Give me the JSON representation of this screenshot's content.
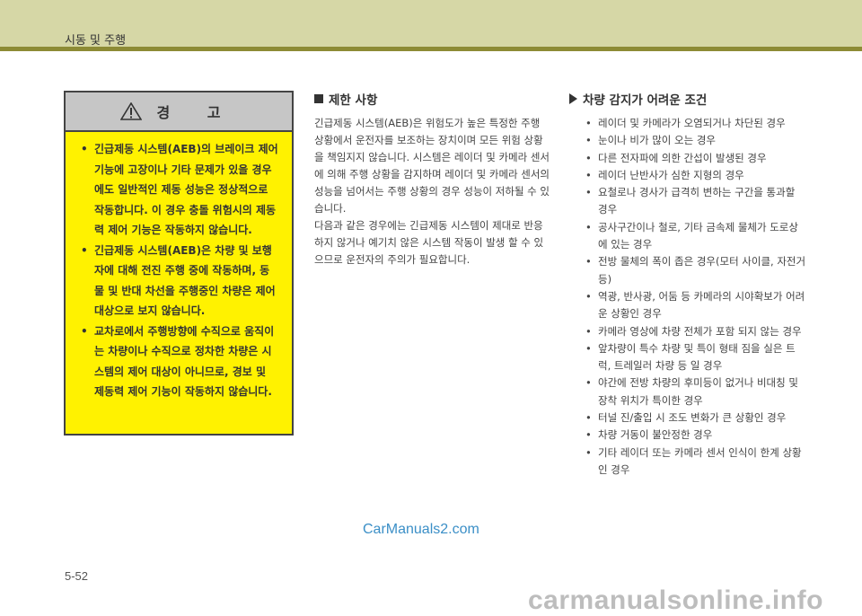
{
  "header": {
    "title": "시동 및 주행"
  },
  "warning": {
    "title": "경 고",
    "items": [
      "긴급제동 시스템(AEB)의 브레이크 제어 기능에 고장이나 기타 문제가 있을 경우에도 일반적인 제동 성능은 정상적으로 작동합니다. 이 경우 충돌 위험시의 제동력 제어 기능은 작동하지 않습니다.",
      "긴급제동 시스템(AEB)은 차량 및 보행자에 대해 전진 주행 중에 작동하며, 동물 및 반대 차선을 주행중인 차량은 제어대상으로 보지 않습니다.",
      "교차로에서 주행방향에 수직으로 움직이는 차량이나 수직으로 정차한 차량은 시스템의 제어 대상이 아니므로, 경보 및 제동력 제어 기능이 작동하지 않습니다."
    ]
  },
  "limitations": {
    "heading": "제한 사항",
    "paragraphs": [
      "긴급제동 시스템(AEB)은 위험도가 높은 특정한 주행 상황에서 운전자를 보조하는 장치이며 모든 위험 상황을 책임지지 않습니다. 시스템은 레이더 및 카메라 센서에 의해 주행 상황을 감지하며 레이더 및 카메라 센서의 성능을 넘어서는 주행 상황의 경우 성능이 저하될 수 있습니다.",
      "다음과 같은 경우에는 긴급제동 시스템이 제대로 반응하지 않거나 예기치 않은 시스템 작동이 발생 할 수 있으므로 운전자의 주의가 필요합니다."
    ]
  },
  "conditions": {
    "heading": "차량 감지가 어려운 조건",
    "items": [
      "레이더 및 카메라가 오염되거나 차단된 경우",
      "눈이나 비가 많이 오는 경우",
      "다른 전자파에 의한 간섭이 발생된 경우",
      "레이더 난반사가 심한 지형의 경우",
      "요철로나 경사가 급격히 변하는 구간을 통과할 경우",
      "공사구간이나 철로, 기타 금속제 물체가 도로상에 있는 경우",
      "전방 물체의 폭이 좁은 경우(모터 사이클, 자전거 등)",
      "역광, 반사광, 어둠 등 카메라의 시야확보가 어려운 상황인 경우",
      "카메라 영상에 차량 전체가 포함 되지 않는 경우",
      "앞차량이 특수 차량 및 특이 형태 짐을 실은 트럭, 트레일러 차량 등 일 경우",
      "야간에 전방 차량의 후미등이 없거나 비대칭 및 장착 위치가 특이한 경우",
      "터널 진/출입 시 조도 변화가 큰 상황인 경우",
      "차량 거동이 불안정한 경우",
      "기타 레이더 또는 카메라 센서 인식이 한계 상황인 경우"
    ]
  },
  "watermark": "CarManuals2.com",
  "page_number": "5-52",
  "footer_watermark": "carmanualsonline.info",
  "colors": {
    "header_bg": "#d6d7a6",
    "header_rule": "#8d8b35",
    "warning_bg": "#fff200",
    "warning_head_bg": "#c6c6c6",
    "watermark": "#3b8fc7"
  }
}
